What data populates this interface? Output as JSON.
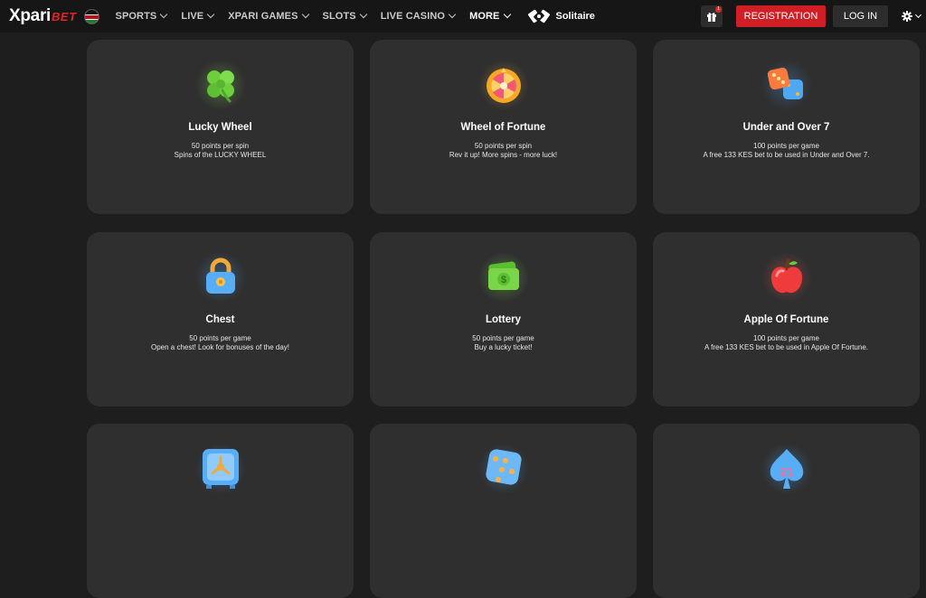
{
  "header": {
    "logo_main": "Xpari",
    "logo_accent": "BET",
    "nav": [
      {
        "label": "SPORTS"
      },
      {
        "label": "LIVE"
      },
      {
        "label": "XPARI GAMES"
      },
      {
        "label": "SLOTS"
      },
      {
        "label": "LIVE CASINO"
      },
      {
        "label": "MORE"
      }
    ],
    "solitaire_label": "Solitaire",
    "gift_badge": "1",
    "register_label": "REGISTRATION",
    "login_label": "LOG IN"
  },
  "colors": {
    "background": "#1e1e1e",
    "topbar": "#161616",
    "card": "#2f2f2f",
    "accent_red": "#d01f24"
  },
  "cards": [
    {
      "icon": "clover-icon",
      "title": "Lucky Wheel",
      "line1": "50 points per spin",
      "line2": "Spins of the LUCKY WHEEL"
    },
    {
      "icon": "fortune-wheel-icon",
      "title": "Wheel of Fortune",
      "line1": "50 points per spin",
      "line2": "Rev it up! More spins - more luck!"
    },
    {
      "icon": "dice-pair-icon",
      "title": "Under and Over 7",
      "line1": "100 points per game",
      "line2": "A free 133 KES bet to be used in Under and Over 7."
    },
    {
      "icon": "padlock-chest-icon",
      "title": "Chest",
      "line1": "50 points per game",
      "line2": "Open a chest! Look for bonuses of the day!"
    },
    {
      "icon": "lottery-ticket-icon",
      "title": "Lottery",
      "line1": "50 points per game",
      "line2": "Buy a lucky ticket!"
    },
    {
      "icon": "apple-icon",
      "title": "Apple Of Fortune",
      "line1": "100 points per game",
      "line2": "A free 133 KES bet to be used in Apple Of Fortune."
    },
    {
      "icon": "safe-icon",
      "title": "",
      "line1": "",
      "line2": ""
    },
    {
      "icon": "dice-icon",
      "title": "",
      "line1": "",
      "line2": ""
    },
    {
      "icon": "spade-21-icon",
      "title": "",
      "line1": "",
      "line2": "",
      "icon_text": "21"
    }
  ]
}
